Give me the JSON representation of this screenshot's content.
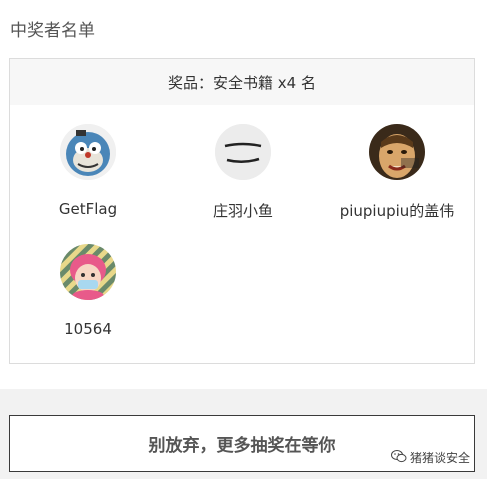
{
  "page": {
    "title": "中奖者名单"
  },
  "prize": {
    "label": "奖品：安全书籍 x4 名"
  },
  "winners": [
    {
      "name": "GetFlag",
      "avatar": "cartoon-cat-avatar"
    },
    {
      "name": "庄羽小鱼",
      "avatar": "sketch-line-avatar"
    },
    {
      "name": "piupiupiu的盖伟",
      "avatar": "meme-face-avatar"
    },
    {
      "name": "10564",
      "avatar": "anime-girl-avatar"
    }
  ],
  "cta": {
    "label": "别放弃，更多抽奖在等你"
  },
  "watermark": {
    "label": "猪猪谈安全",
    "icon": "wechat-icon"
  }
}
